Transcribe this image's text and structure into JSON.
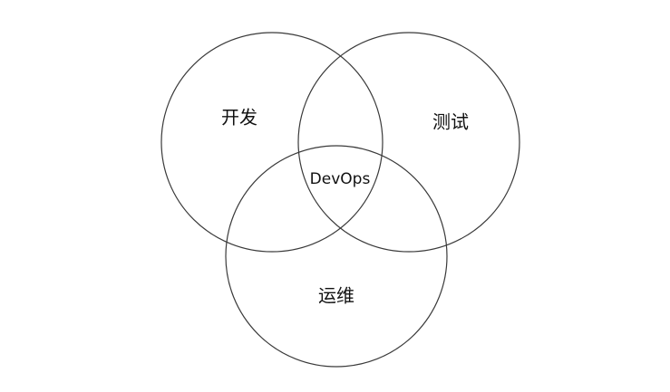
{
  "diagram": {
    "sets": [
      {
        "id": "dev",
        "label": "开发"
      },
      {
        "id": "test",
        "label": "测试"
      },
      {
        "id": "ops",
        "label": "运维"
      }
    ],
    "intersection_label": "DevOps",
    "stroke_color": "#3a3a3a",
    "background": "#ffffff"
  }
}
